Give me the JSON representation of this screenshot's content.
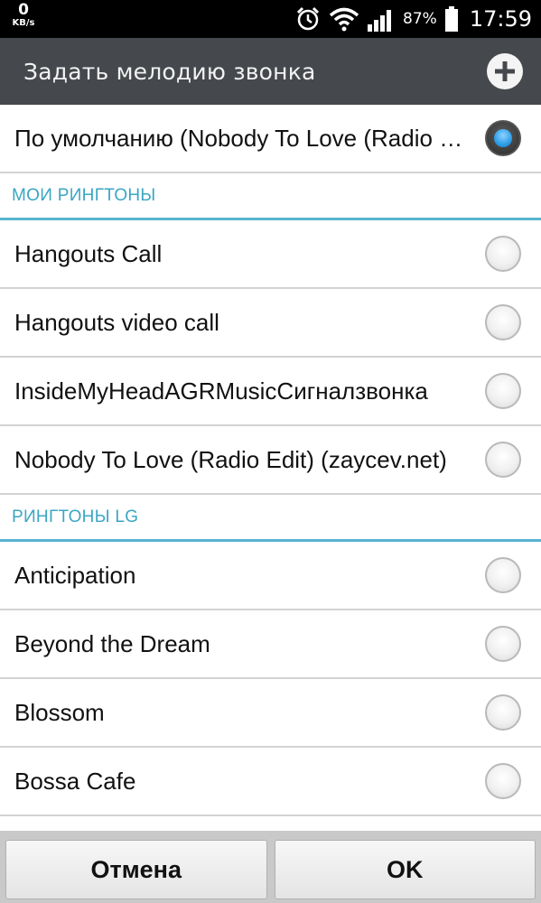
{
  "status_bar": {
    "net_speed_value": "0",
    "net_speed_unit": "KB/s",
    "icons": [
      "alarm-icon",
      "wifi-icon",
      "signal-icon",
      "battery-icon"
    ],
    "battery_percent": "87%",
    "time": "17:59"
  },
  "title_bar": {
    "title": "Задать мелодию звонка",
    "add_icon": "plus-circle-icon"
  },
  "default_item": {
    "label": "По умолчанию (Nobody To Love (Radio Edit) (zaycev.net))",
    "selected": true
  },
  "sections": [
    {
      "header": "МОИ РИНГТОНЫ",
      "items": [
        {
          "label": "Hangouts Call",
          "selected": false
        },
        {
          "label": "Hangouts video call",
          "selected": false
        },
        {
          "label": "InsideMyHeadAGRMusicСигналзвонка",
          "selected": false
        },
        {
          "label": "Nobody To Love (Radio Edit) (zaycev.net)",
          "selected": false
        }
      ]
    },
    {
      "header": "РИНГТОНЫ LG",
      "items": [
        {
          "label": "Anticipation",
          "selected": false
        },
        {
          "label": "Beyond the Dream",
          "selected": false
        },
        {
          "label": "Blossom",
          "selected": false
        },
        {
          "label": "Bossa Cafe",
          "selected": false
        }
      ]
    }
  ],
  "buttons": {
    "cancel_label": "Отмена",
    "ok_label": "OK"
  },
  "colors": {
    "accent": "#3aa6c4",
    "title_bar": "#45484c",
    "selected_dot": "#2d9ee8"
  }
}
